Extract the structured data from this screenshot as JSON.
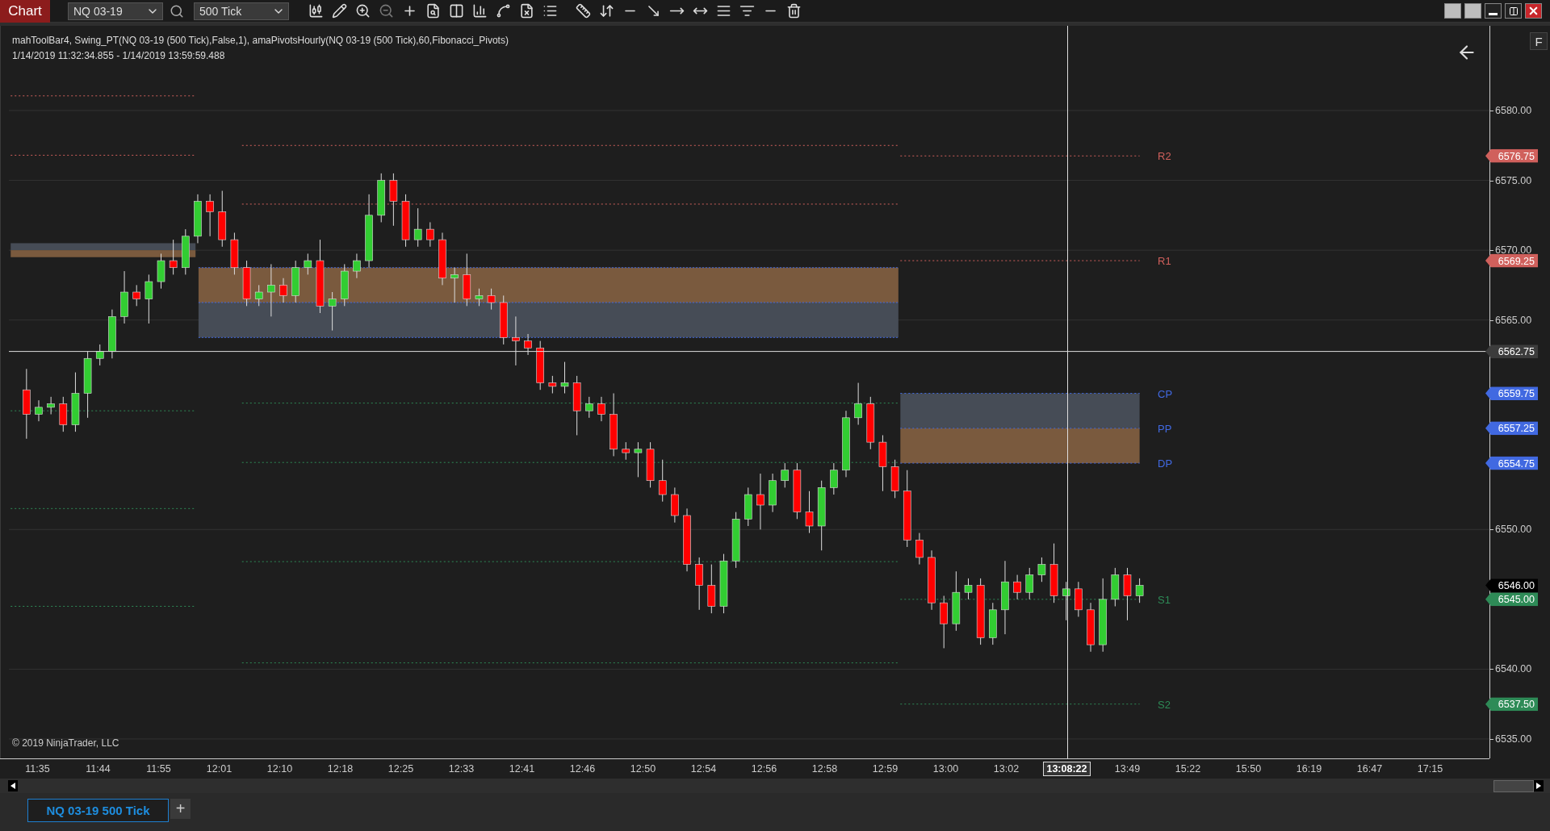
{
  "window": {
    "title": "Chart"
  },
  "toolbar": {
    "instrument": "NQ 03-19",
    "interval": "500 Tick"
  },
  "chart": {
    "indicators": "mahToolBar4, Swing_PT(NQ 03-19 (500 Tick),False,1), amaPivotsHourly(NQ 03-19 (500 Tick),60,Fibonacci_Pivots)",
    "date_range": "1/14/2019 11:32:34.855 - 1/14/2019 13:59:59.488",
    "copyright": "© 2019 NinjaTrader, LLC",
    "f_button": "F",
    "price_axis": [
      "6580.00",
      "6575.00",
      "6570.00",
      "6565.00",
      "6550.00",
      "6540.00",
      "6535.00"
    ],
    "pivots": [
      {
        "label": "R2",
        "tag": "6576.75",
        "kind": "outer",
        "color": "#d0605c"
      },
      {
        "label": "R1",
        "tag": "6569.25",
        "kind": "outer",
        "color": "#d0605c"
      },
      {
        "label": "CP",
        "tag": "6559.75",
        "kind": "central",
        "color": "#4169e1"
      },
      {
        "label": "PP",
        "tag": "6557.25",
        "kind": "central",
        "color": "#4169e1"
      },
      {
        "label": "DP",
        "tag": "6554.75",
        "kind": "central",
        "color": "#4169e1"
      },
      {
        "label": "S1",
        "tag": "6545.00",
        "kind": "outer",
        "color": "#2e8b57"
      },
      {
        "label": "S2",
        "tag": "6537.50",
        "kind": "outer",
        "color": "#2e8b57"
      }
    ],
    "price_markers": [
      {
        "kind": "crosshair",
        "label": "6562.75"
      },
      {
        "kind": "last",
        "label": "6546.00"
      }
    ],
    "time_axis": [
      {
        "label": "11:35",
        "selected": false
      },
      {
        "label": "11:44",
        "selected": false
      },
      {
        "label": "11:55",
        "selected": false
      },
      {
        "label": "12:01",
        "selected": false
      },
      {
        "label": "12:10",
        "selected": false
      },
      {
        "label": "12:18",
        "selected": false
      },
      {
        "label": "12:25",
        "selected": false
      },
      {
        "label": "12:33",
        "selected": false
      },
      {
        "label": "12:41",
        "selected": false
      },
      {
        "label": "12:46",
        "selected": false
      },
      {
        "label": "12:50",
        "selected": false
      },
      {
        "label": "12:54",
        "selected": false
      },
      {
        "label": "12:56",
        "selected": false
      },
      {
        "label": "12:58",
        "selected": false
      },
      {
        "label": "12:59",
        "selected": false
      },
      {
        "label": "13:00",
        "selected": false
      },
      {
        "label": "13:02",
        "selected": false
      },
      {
        "label": "13:08:22",
        "selected": true
      },
      {
        "label": "13:49",
        "selected": false
      },
      {
        "label": "15:22",
        "selected": false
      },
      {
        "label": "15:50",
        "selected": false
      },
      {
        "label": "16:19",
        "selected": false
      },
      {
        "label": "16:47",
        "selected": false
      },
      {
        "label": "17:15",
        "selected": false
      }
    ]
  },
  "tabs": [
    {
      "label": "NQ 03-19 500 Tick",
      "selected": true
    }
  ],
  "add_tab": "+"
}
